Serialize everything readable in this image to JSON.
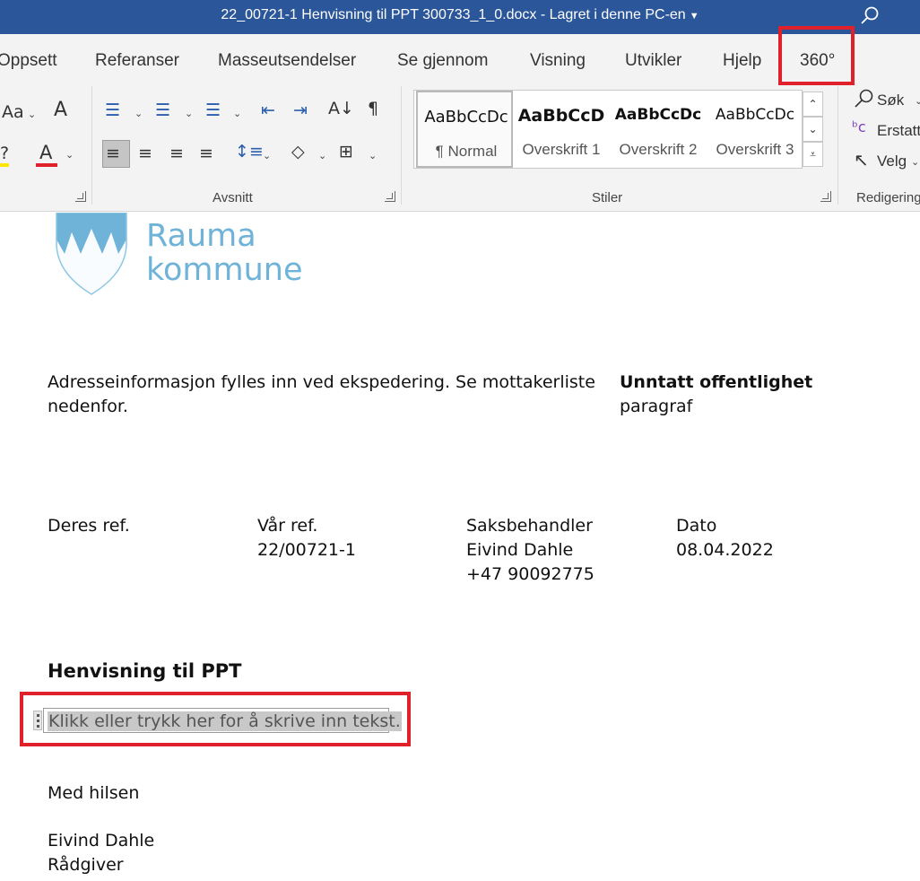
{
  "titlebar": {
    "title": "22_00721-1 Henvisning til PPT 300733_1_0.docx  -  Lagret i denne PC-en",
    "search_icon": "search-icon"
  },
  "tabs": [
    "Oppsett",
    "Referanser",
    "Masseutsendelser",
    "Se gjennom",
    "Visning",
    "Utvikler",
    "Hjelp",
    "360°"
  ],
  "ribbon": {
    "font_group": {
      "change_case": "Aa"
    },
    "paragraph_group": {
      "label": "Avsnitt"
    },
    "styles_group": {
      "label": "Stiler",
      "styles": [
        {
          "sample": "AaBbCcDc",
          "name": "¶ Normal"
        },
        {
          "sample": "AaBbCcD",
          "name": "Overskrift 1"
        },
        {
          "sample": "AaBbCcDc",
          "name": "Overskrift 2"
        },
        {
          "sample": "AaBbCcDc",
          "name": "Overskrift 3"
        }
      ]
    },
    "editing_group": {
      "label": "Redigering",
      "search": "Søk",
      "replace": "Erstatt",
      "select": "Velg"
    }
  },
  "document": {
    "logo": {
      "line1": "Rauma",
      "line2": "kommune"
    },
    "address": {
      "line1": "Adresseinformasjon fylles inn ved ekspedering. Se mottakerliste",
      "line2": "nedenfor."
    },
    "classification": {
      "title": "Unntatt offentlighet",
      "sub": "paragraf"
    },
    "refs": {
      "deres_ref_label": "Deres ref.",
      "var_ref_label": "Vår ref.",
      "var_ref_value": "22/00721-1",
      "saksbehandler_label": "Saksbehandler",
      "saksbehandler_name": "Eivind Dahle",
      "saksbehandler_phone": "+47 90092775",
      "dato_label": "Dato",
      "dato_value": "08.04.2022"
    },
    "heading": "Henvisning til PPT",
    "placeholder": "Klikk eller trykk her for å skrive inn tekst.",
    "closing": "Med hilsen",
    "signer_name": "Eivind Dahle",
    "signer_title": "Rådgiver"
  },
  "colors": {
    "titlebar": "#2b579a",
    "highlight": "#e0202a",
    "logo": "#6fb3d9"
  }
}
